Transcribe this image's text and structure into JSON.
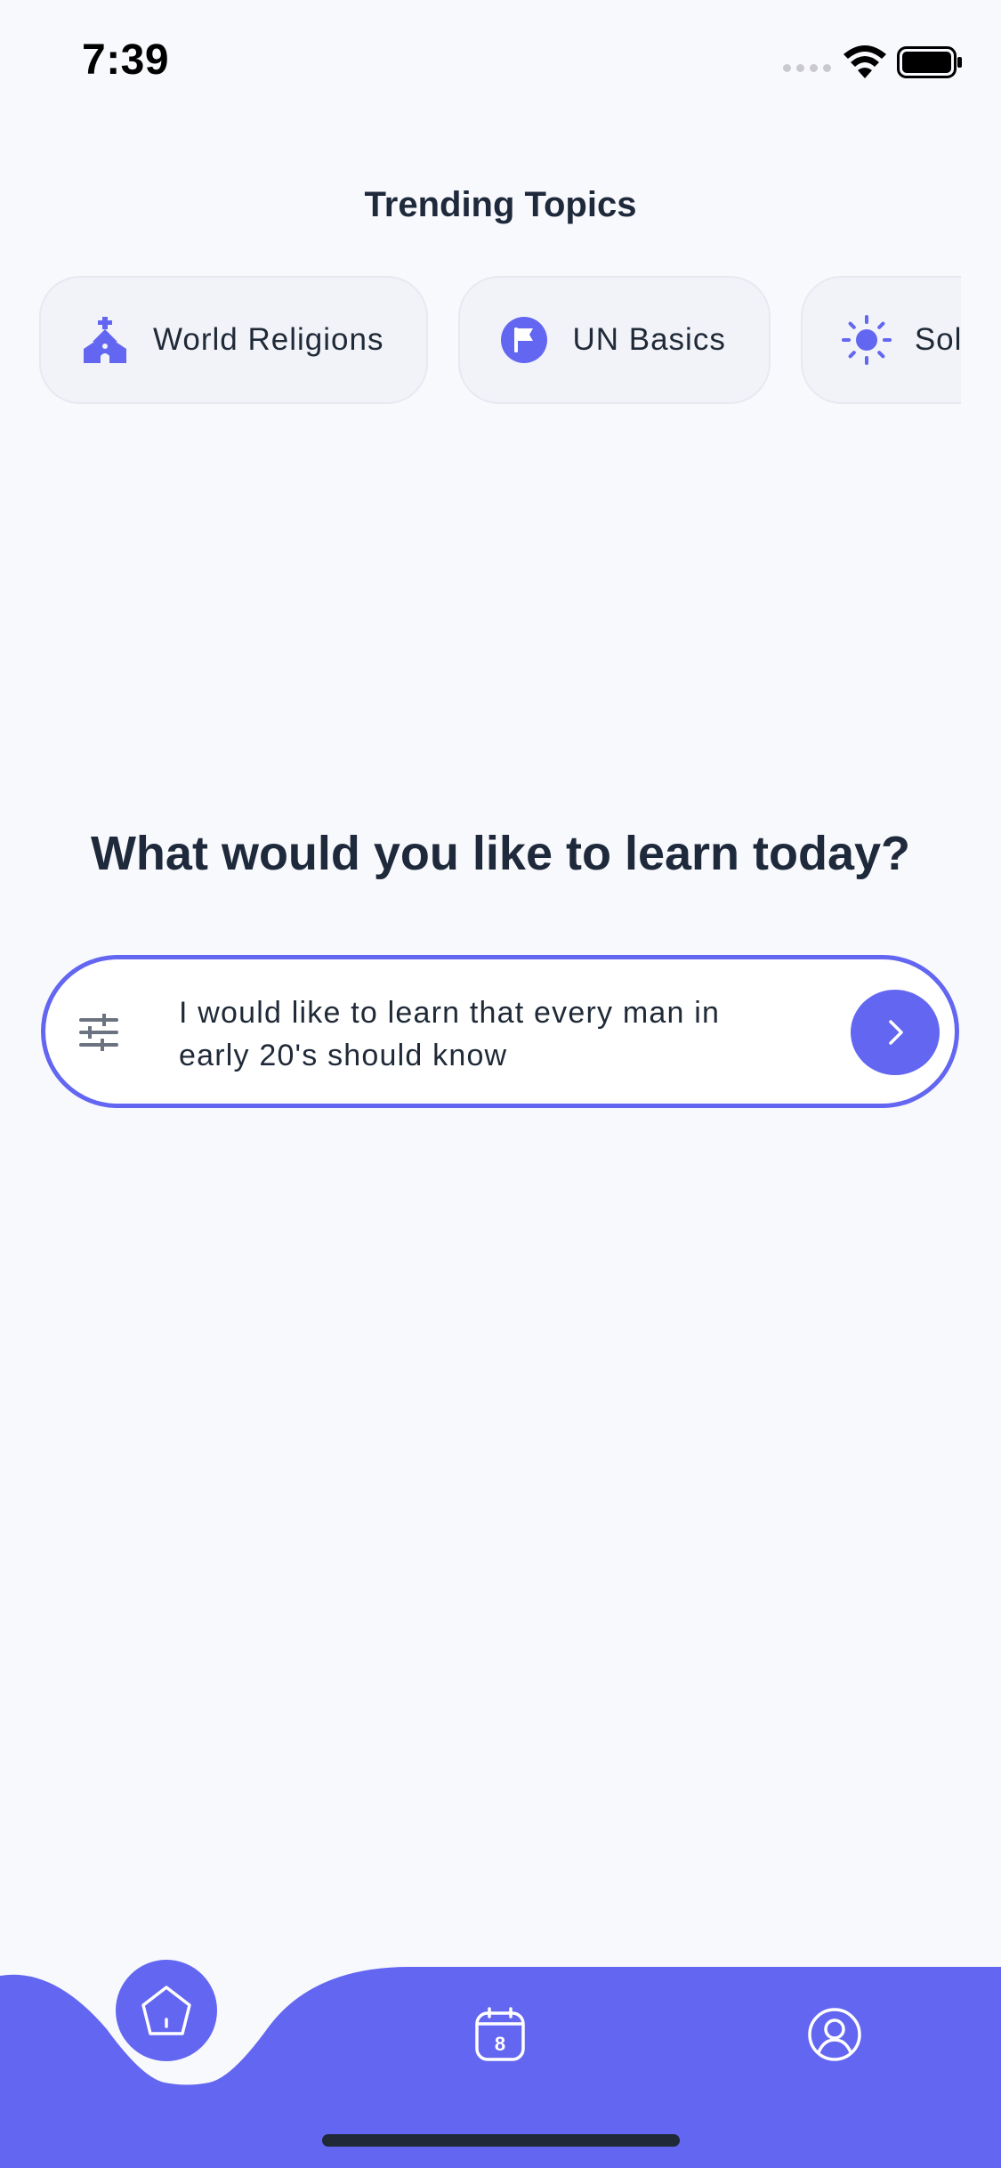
{
  "status_bar": {
    "time": "7:39"
  },
  "trending": {
    "title": "Trending Topics",
    "topics": [
      {
        "label": "World Religions",
        "icon": "church-icon"
      },
      {
        "label": "UN Basics",
        "icon": "flag-icon"
      },
      {
        "label": "Solar",
        "icon": "sun-icon"
      }
    ]
  },
  "main": {
    "headline": "What would you like to learn today?",
    "query": "I would like to learn that every man in early 20's should know"
  },
  "nav": {
    "items": [
      {
        "name": "home",
        "icon": "home-icon",
        "active": true
      },
      {
        "name": "calendar",
        "icon": "calendar-icon",
        "badge": "8"
      },
      {
        "name": "profile",
        "icon": "profile-icon"
      }
    ]
  },
  "colors": {
    "accent": "#6366f1",
    "background": "#f8f9fc",
    "text": "#1e293b"
  }
}
